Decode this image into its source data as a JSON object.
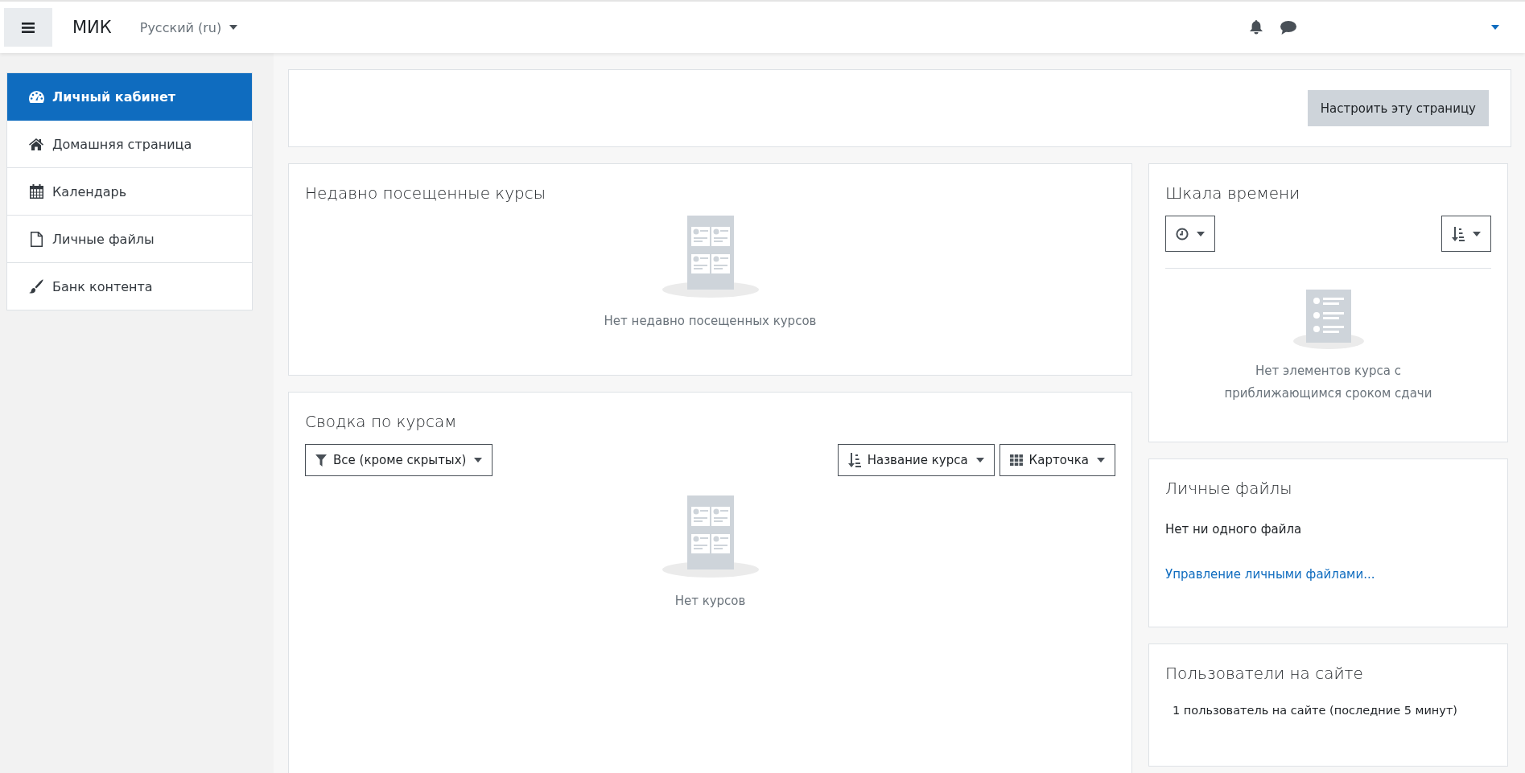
{
  "navbar": {
    "site_name": "МИК",
    "language": "Русский (ru)"
  },
  "sidebar": {
    "items": [
      {
        "label": "Личный кабинет",
        "kind": "dashboard",
        "selected": true
      },
      {
        "label": "Домашняя страница",
        "kind": "home",
        "selected": false
      },
      {
        "label": "Календарь",
        "kind": "calendar",
        "selected": false
      },
      {
        "label": "Личные файлы",
        "kind": "files",
        "selected": false
      },
      {
        "label": "Банк контента",
        "kind": "content",
        "selected": false
      }
    ]
  },
  "page_header": {
    "button": "Настроить эту страницу"
  },
  "recent_courses": {
    "title": "Недавно посещенные курсы",
    "empty_text": "Нет недавно посещенных курсов"
  },
  "course_overview": {
    "title": "Сводка по курсам",
    "filter": "Все (кроме скрытых)",
    "sort": "Название курса",
    "view": "Карточка",
    "empty_text": "Нет курсов"
  },
  "timeline": {
    "title": "Шкала времени",
    "empty_text": "Нет элементов курса с приближающимся сроком сдачи"
  },
  "private_files": {
    "title": "Личные файлы",
    "text": "Нет ни одного файла",
    "link": "Управление личными файлами..."
  },
  "online_users": {
    "title": "Пользователи на сайте",
    "text": "1 пользователь на сайте (последние 5 минут)"
  }
}
